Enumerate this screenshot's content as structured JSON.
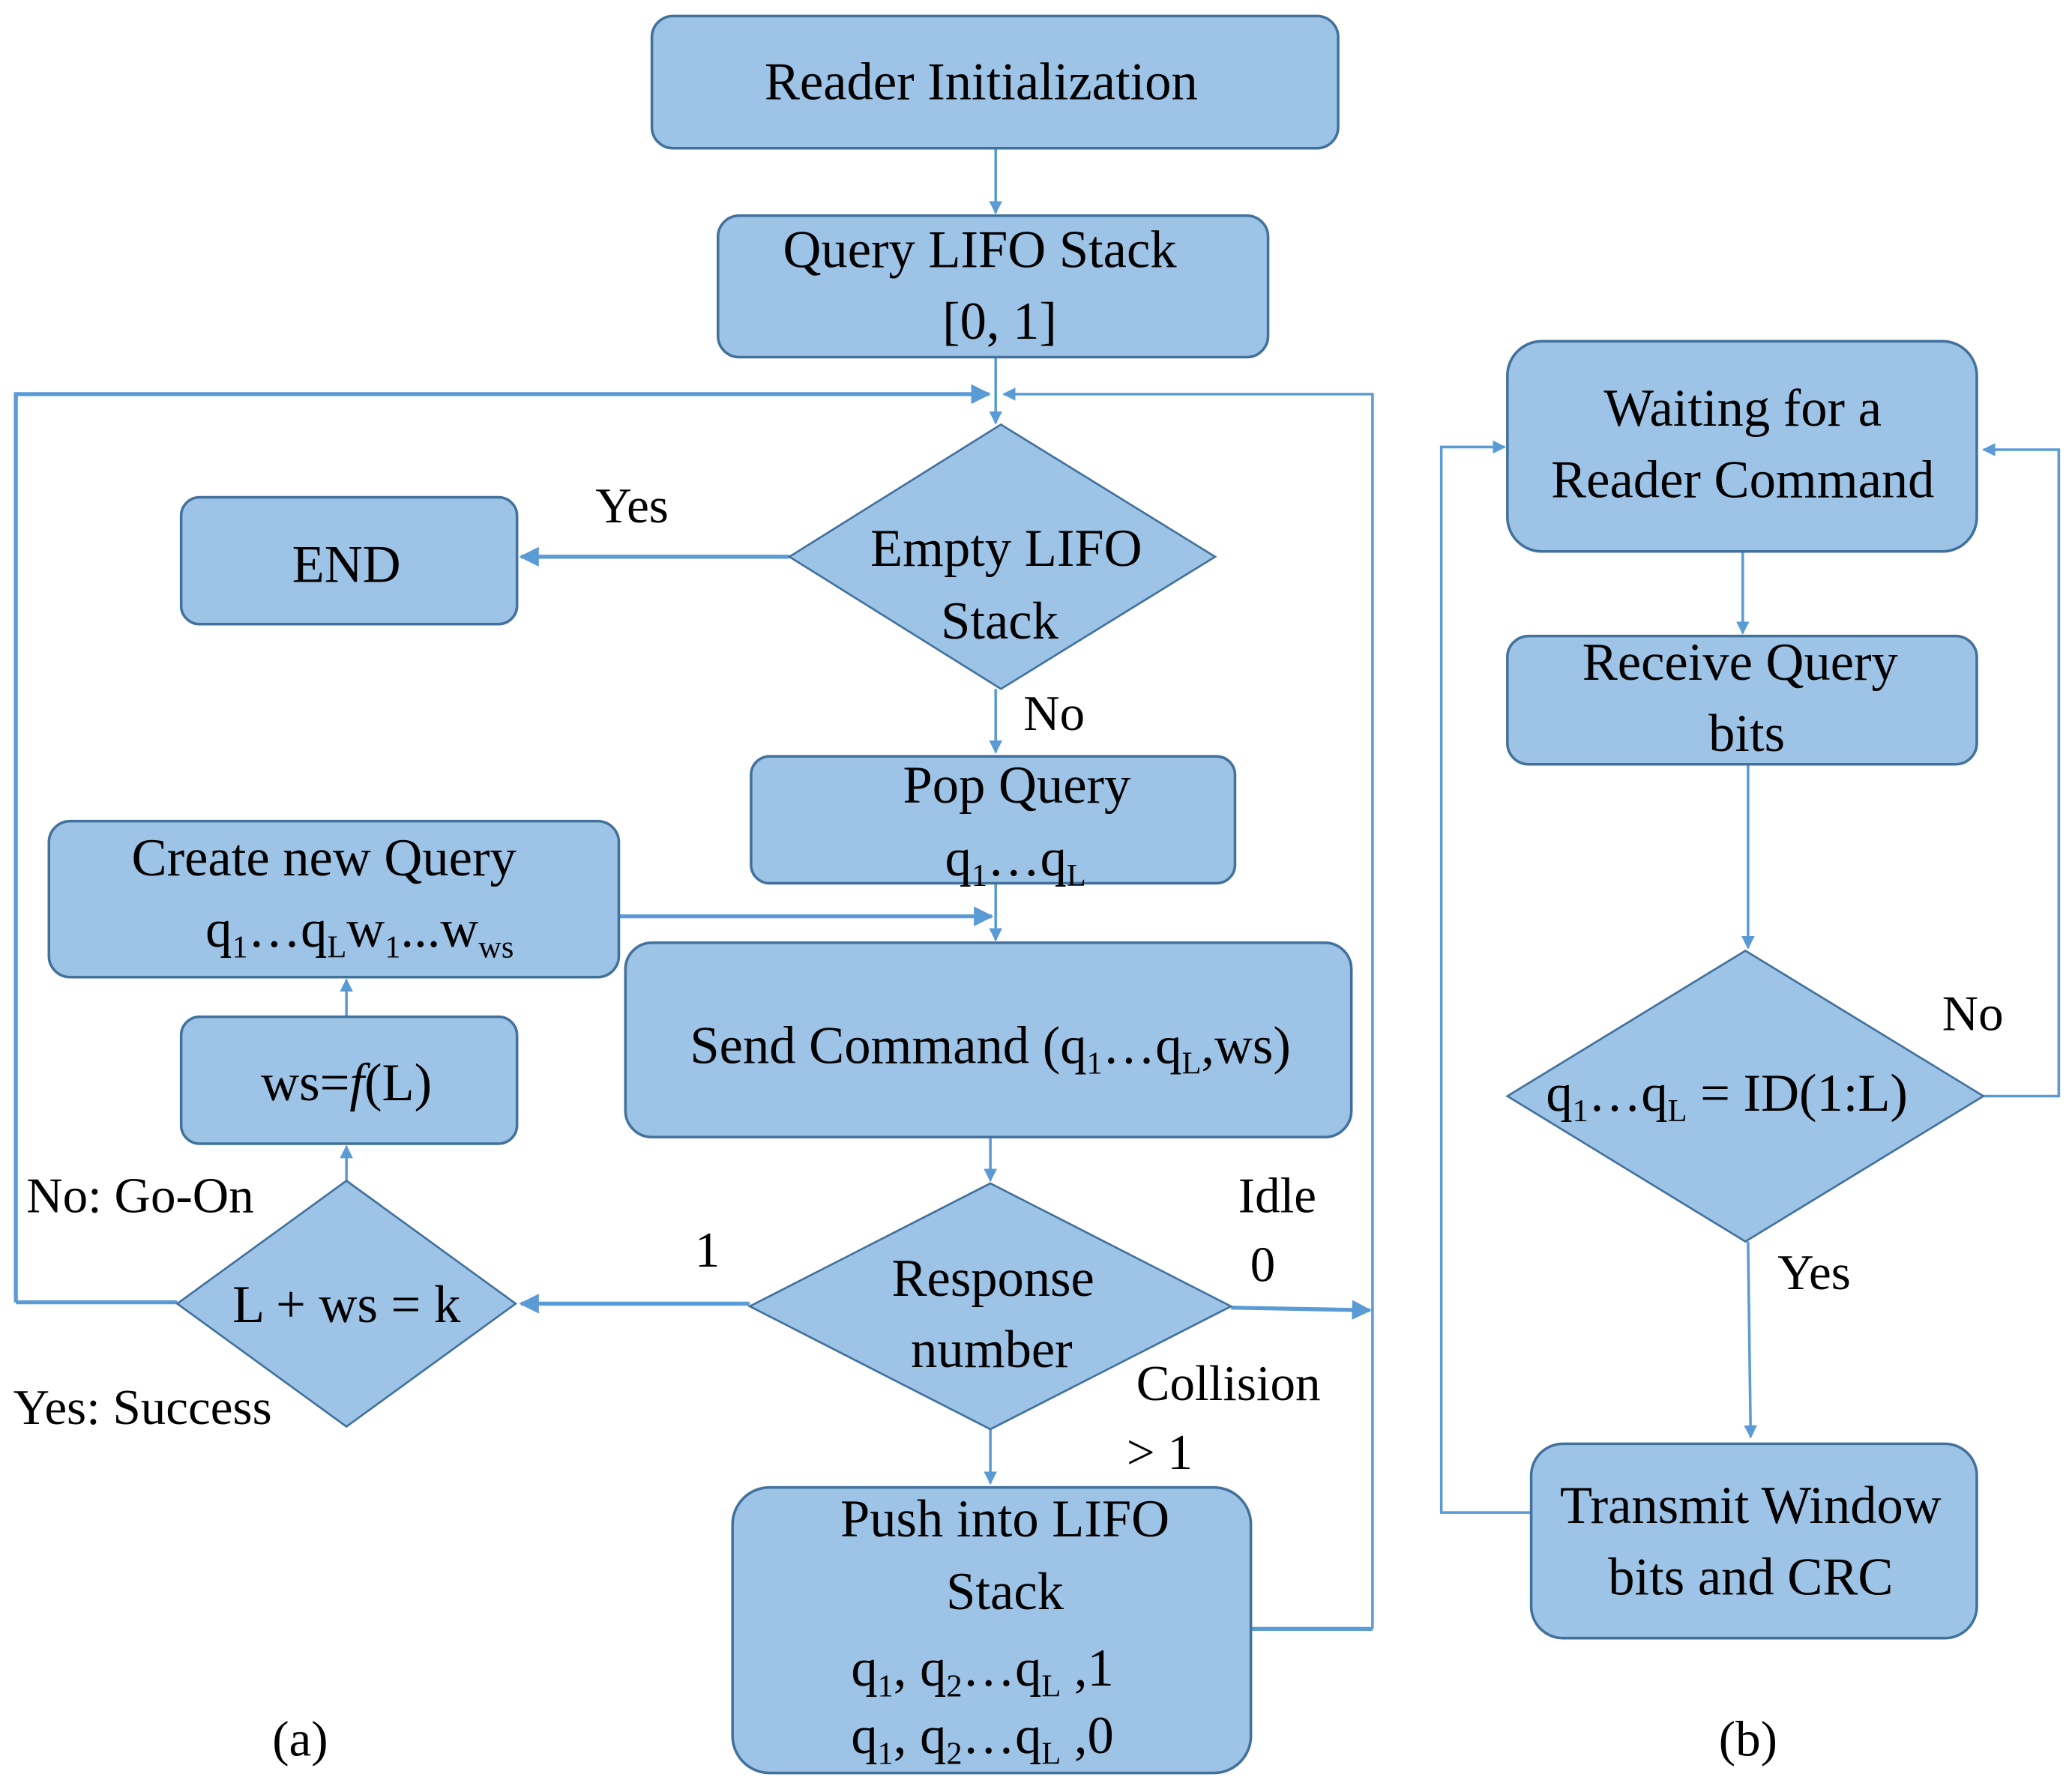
{
  "figure": {
    "panel_a_caption": "(a)",
    "panel_b_caption": "(b)",
    "colors": {
      "node_fill": "#9DC3E6",
      "node_border": "#41719C",
      "connector": "#5B9BD5",
      "text": "#000000",
      "background": "#FFFFFF"
    }
  },
  "panel_a": {
    "nodes": {
      "reader_init": {
        "type": "process",
        "lines": [
          "Reader Initialization"
        ]
      },
      "query_stack": {
        "type": "process",
        "lines": [
          "Query LIFO Stack",
          "[0, 1]"
        ]
      },
      "empty_stack": {
        "type": "decision",
        "lines": [
          "Empty LIFO",
          "Stack"
        ]
      },
      "end": {
        "type": "terminal",
        "lines": [
          "END"
        ]
      },
      "pop_query": {
        "type": "process",
        "lines": [
          "Pop Query"
        ],
        "formula": {
          "q": "q",
          "sub1": "1",
          "dots": "…",
          "subL": "L"
        }
      },
      "create_query": {
        "type": "process",
        "lines": [
          "Create new Query"
        ],
        "formula": {
          "q": "q",
          "sub1": "1",
          "dots": "…",
          "subL": "L",
          "w": "w",
          "dots2": "...",
          "subws": "ws"
        }
      },
      "send_command": {
        "type": "process",
        "prefix": "Send Command (",
        "q": "q",
        "sub1": "1",
        "dots": "…",
        "subL": "L",
        "suffix": ",ws)"
      },
      "ws_func": {
        "type": "process",
        "left": "ws=",
        "func": "f",
        "right": "(L)"
      },
      "check_k": {
        "type": "decision",
        "lines": [
          "L + ws = k"
        ]
      },
      "response": {
        "type": "decision",
        "lines": [
          "Response",
          "number"
        ]
      },
      "push_stack": {
        "type": "process",
        "lines": [
          "Push into LIFO",
          "Stack"
        ],
        "entries": [
          {
            "q": "q",
            "sub1": "1",
            "sep": ", ",
            "sub2": "2",
            "dots": "…",
            "subL": "L",
            "suffix": " ,1"
          },
          {
            "q": "q",
            "sub1": "1",
            "sep": ", ",
            "sub2": "2",
            "dots": "…",
            "subL": "L",
            "suffix": " ,0"
          }
        ]
      }
    },
    "edge_labels": {
      "yes_end": "Yes",
      "no_pop": "No",
      "one": "1",
      "idle": "Idle",
      "zero": "0",
      "collision": "Collision",
      "gt_one": "> 1",
      "no_go_on": "No: Go-On",
      "yes_success": "Yes: Success"
    }
  },
  "panel_b": {
    "nodes": {
      "waiting": {
        "type": "process",
        "lines": [
          "Waiting for a",
          "Reader Command"
        ]
      },
      "receive": {
        "type": "process",
        "lines": [
          "Receive Query",
          "bits"
        ]
      },
      "compare": {
        "type": "decision",
        "q": "q",
        "sub1": "1",
        "dots": "…",
        "subL": "L",
        "rhs": " = ID(1:L)"
      },
      "transmit": {
        "type": "process",
        "lines": [
          "Transmit Window",
          "bits and CRC"
        ]
      }
    },
    "edge_labels": {
      "no": "No",
      "yes": "Yes"
    }
  }
}
